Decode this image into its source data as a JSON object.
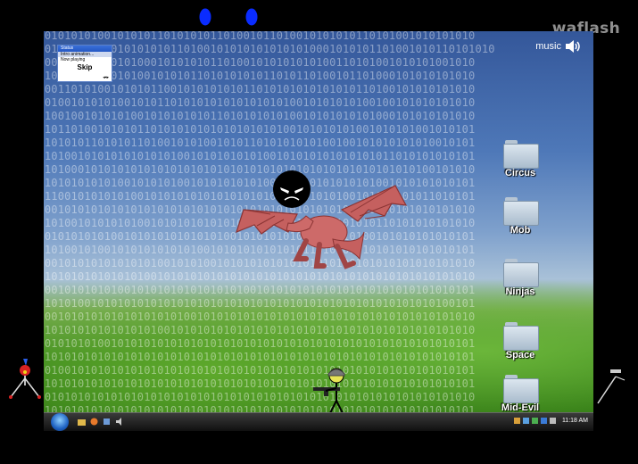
{
  "watermark": "waflash",
  "status_window": {
    "title": "Status",
    "items": [
      "Intro animation...",
      "Now playing"
    ],
    "skip_label": "Skip"
  },
  "music": {
    "label": "music",
    "icon": "speaker-icon"
  },
  "folders": [
    "Circus",
    "Mob",
    "Ninjas",
    "Space",
    "Mid-Evil"
  ],
  "taskbar": {
    "clock": "11:18 AM"
  },
  "colors": {
    "stick_head": "#0a2cff",
    "dragon": "#c5605f",
    "folder": "#c3d2e0",
    "taskbar": "#1b1b1b"
  },
  "binary_rows": [
    "1001010101001010101101010101101001011010010101010110101001010101010",
    "1001010101000101010101101001010101010101010001010101101001010110101010",
    "0100101010010101000101010101101001010101010100110101001010101001010",
    "1010011010010101001010101101010101011010110100101101000101010101010",
    "0100110101001010101100101010101011010101010101010110100101010101010",
    "1001001010101001010110101010101010101010010101010100100101010101010",
    "0110010010101010010101010101101010101010010101010101000101010101010",
    "1010110100101010110101010101010101010100101010101001010101001010101",
    "0010101011010101101001010100101011010101010100100101010101010010101",
    "1010100101010101010101001010101010100101010101010101011010101010101",
    "1010100010101010101010101010101010101010101010101010101010100101010",
    "0110101010101001010101001010101010100101010101010101001010101010101",
    "1011001010101010010101010101010101010100101010100101010101011010101",
    "0100101010101010101010101010101010101010101010101010010101010101010",
    "1010100101010101001010101010101001010100101010101010110101010101010",
    "0101010101010010101010101010100101010101010101010100101010101010101",
    "1010100101001010101010101001010101010101011010101010101010101010101",
    "0100101010101010101001010100101010101010101010100101010101010101010",
    "1010101010101010100101010101010101010101010101010101010101010101010",
    "0100101010101001010101010101010100101010101010101010101010101010101",
    "1010101001010101010101010101010101010101010101010101010101010100101",
    "0100101010101010101010100101010101010101010101010101010101010101010",
    "1010101010101010101001010101010101010101010101010101010101010101010",
    "0101010101001010101010101010101010101010101010101010101010101010101",
    "1010101010101010101010101010101010101010101010101010101010101010101",
    "0101001010101010101010101010101010101010101010101010101010101010101",
    "1010101010101010101010101010101010101010101010101010101010101010101",
    "0101010101010101010101010101010101010101010101010101010101010101010",
    "1010101010101010101010101010101010101010101010101010101010101010101"
  ]
}
